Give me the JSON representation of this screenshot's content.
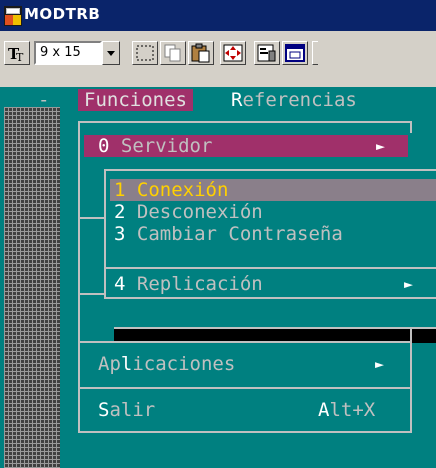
{
  "window": {
    "title": "MODTRB",
    "icon": "ms-dos-app-icon"
  },
  "toolbar": {
    "font_size": "9 x 15",
    "buttons": [
      "mark-icon",
      "copy-icon",
      "paste-icon",
      "fullscreen-icon",
      "properties-icon",
      "background-icon"
    ]
  },
  "menubar": {
    "dash": "-",
    "funciones": "Funciones",
    "referencias_hot": "R",
    "referencias_rest": "eferencias"
  },
  "menu": {
    "servidor": {
      "key": "0",
      "label": " Servidor",
      "arrow": "►"
    },
    "aplicaciones": {
      "label_pre": "Ap",
      "key": "l",
      "label_post": "icaciones",
      "arrow": "►"
    },
    "salir": {
      "key": "S",
      "label": "alir",
      "shortcut_key": "A",
      "shortcut_rest": "lt+X"
    }
  },
  "submenu": {
    "items": [
      {
        "key": "1",
        "label": " Conexión"
      },
      {
        "key": "2",
        "label": " Desconexión"
      },
      {
        "key": "3",
        "label": " Cambiar Contraseña"
      },
      {
        "key": "4",
        "label": " Replicación",
        "arrow": "►"
      }
    ]
  },
  "colors": {
    "console_bg": "#008080",
    "highlight": "#a0306a",
    "selected_sub": "#8a7f8a",
    "selected_text": "#ffd000",
    "text": "#c0c0c0",
    "hotkey": "#ffffff"
  }
}
